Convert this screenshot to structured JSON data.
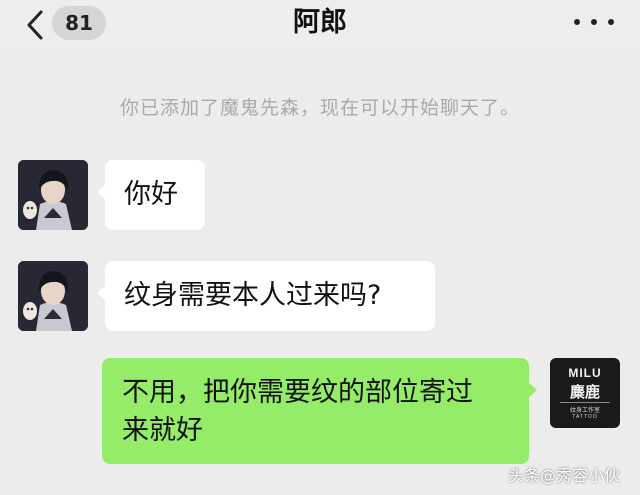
{
  "header": {
    "title": "阿郎",
    "unread_count": "81"
  },
  "system_note": "你已添加了魔鬼先森，现在可以开始聊天了。",
  "messages": [
    {
      "direction": "incoming",
      "text": "你好"
    },
    {
      "direction": "incoming",
      "text": "纹身需要本人过来吗?"
    },
    {
      "direction": "outgoing",
      "text_line1": "不用，把你需要纹的部位寄过",
      "text_line2": "来就好"
    }
  ],
  "self_avatar": {
    "brand": "MILU",
    "brand_cn": "麋鹿",
    "sub": "纹身工作室",
    "sub_en": "TATTOO"
  },
  "watermark": "头条@秀容小伙",
  "colors": {
    "background": "#ececec",
    "incoming_bubble": "#ffffff",
    "outgoing_bubble": "#95ec69",
    "system_text": "#a9a9a9"
  }
}
